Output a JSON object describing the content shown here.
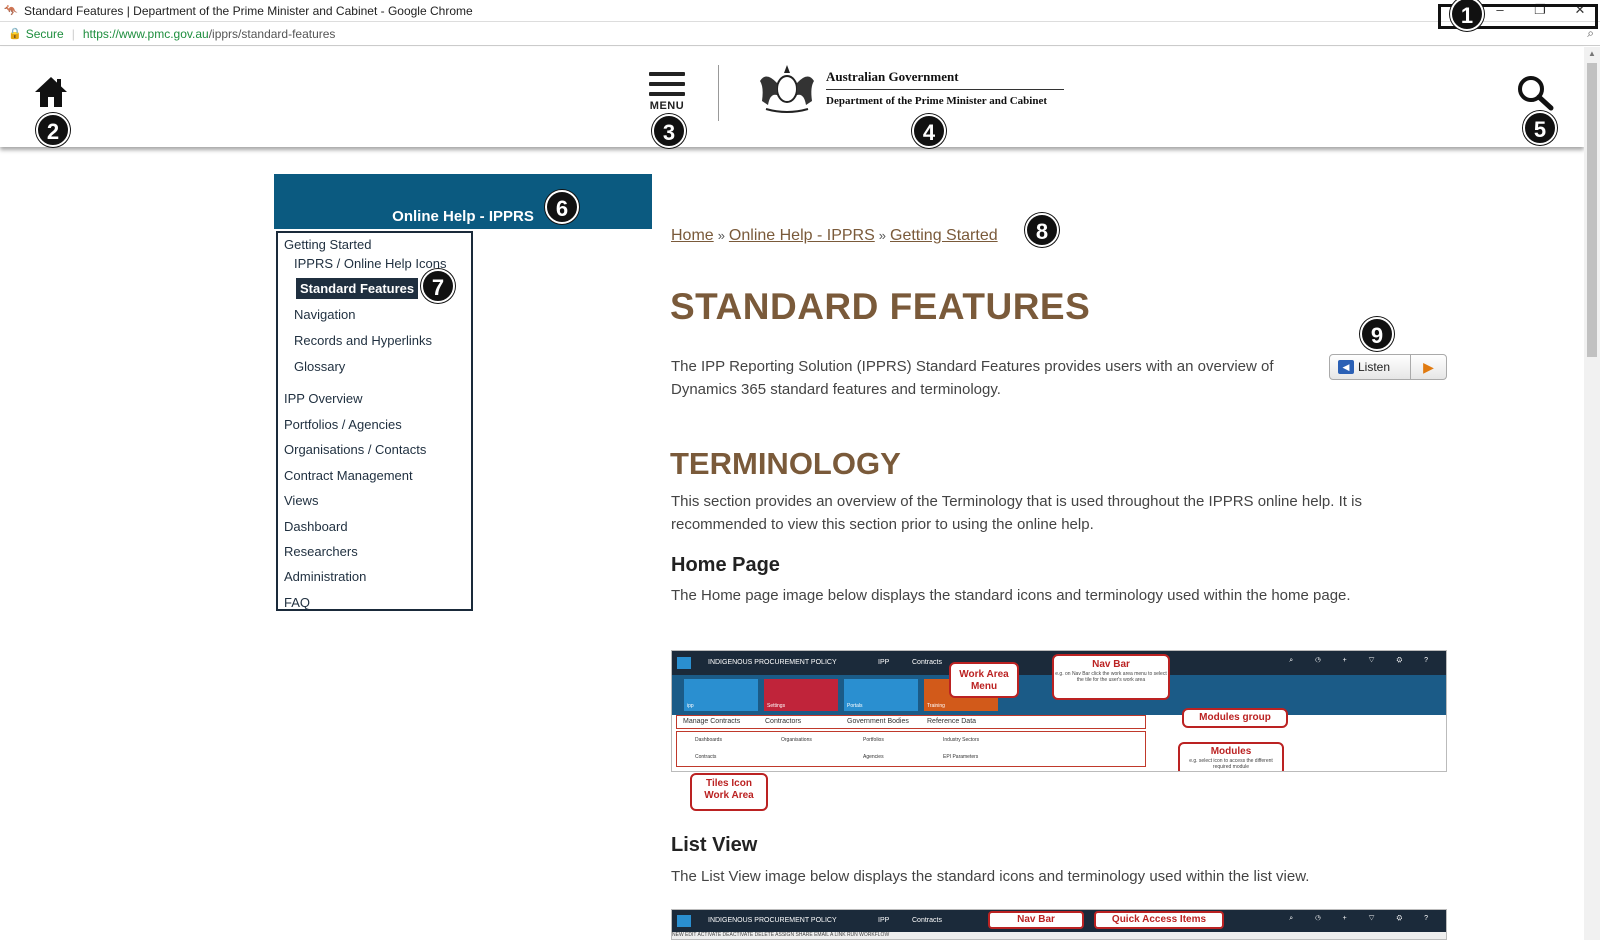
{
  "browser": {
    "window_title": "Standard Features | Department of the Prime Minister and Cabinet - Google Chrome",
    "secure_label": "Secure",
    "url_host": "https://www.pmc.gov.au",
    "url_path": "/ipprs/standard-features",
    "controls": {
      "minimize": "–",
      "restore": "❐",
      "close": "✕"
    }
  },
  "header": {
    "menu_label": "MENU",
    "gov_line1": "Australian Government",
    "gov_line2": "Department of the Prime Minister and Cabinet"
  },
  "markers": [
    "1",
    "2",
    "3",
    "4",
    "5",
    "6",
    "7",
    "8",
    "9"
  ],
  "sidebar": {
    "title": "Online Help - IPPRS",
    "items": [
      {
        "label": "Getting Started"
      },
      {
        "label": "IPPRS / Online Help Icons"
      },
      {
        "label": "Standard Features"
      },
      {
        "label": "Navigation"
      },
      {
        "label": "Records and Hyperlinks"
      },
      {
        "label": "Glossary"
      },
      {
        "label": "IPP Overview"
      },
      {
        "label": "Portfolios / Agencies"
      },
      {
        "label": "Organisations / Contacts"
      },
      {
        "label": "Contract Management"
      },
      {
        "label": "Views"
      },
      {
        "label": "Dashboard"
      },
      {
        "label": "Researchers"
      },
      {
        "label": "Administration"
      },
      {
        "label": "FAQ"
      }
    ]
  },
  "breadcrumb": {
    "home": "Home",
    "section": "Online Help - IPPRS",
    "current": "Getting Started",
    "separator": "»"
  },
  "main": {
    "title": "STANDARD FEATURES",
    "intro": "The IPP Reporting Solution (IPPRS) Standard Features provides users with an overview of Dynamics 365 standard features and terminology.",
    "listen_label": "Listen",
    "terminology_heading": "TERMINOLOGY",
    "terminology_text": "This section provides an overview of the Terminology that is used throughout the IPPRS online help. It is recommended to view this section prior to using the online help.",
    "home_page_heading": "Home Page",
    "home_page_text": "The Home page image below displays the standard icons and terminology used within the home page.",
    "list_view_heading": "List View",
    "list_view_text": "The List View image below displays the standard icons and terminology used within the list view."
  },
  "home_shot": {
    "app_name": "INDIGENOUS PROCUREMENT POLICY",
    "ipp": "IPP",
    "contracts": "Contracts",
    "tiles": [
      "ipp",
      "Settings",
      "Portals",
      "Training"
    ],
    "groups": [
      "Manage Contracts",
      "Contractors",
      "Government Bodies",
      "Reference Data"
    ],
    "modules": [
      "Dashboards",
      "Contracts",
      "Organisations",
      "Portfolios",
      "Agencies",
      "Industry Sectors",
      "EPI Parameters"
    ],
    "callouts": {
      "work_area_menu": "Work Area Menu",
      "nav_bar": "Nav Bar",
      "nav_bar_note": "e.g. on Nav Bar click the work area menu to select the tile for the user's work area",
      "modules_group": "Modules group",
      "modules": "Modules",
      "modules_note": "e.g. select icon to access the different required module",
      "tiles_icon": "Tiles Icon Work Area"
    }
  },
  "list_shot": {
    "app_name": "INDIGENOUS PROCUREMENT POLICY",
    "ipp": "IPP",
    "contracts": "Contracts",
    "nav_bar": "Nav Bar",
    "quick_access": "Quick Access Items",
    "commands": "NEW  EDIT  ACTIVATE  DEACTIVATE  DELETE  ASSIGN  SHARE  EMAIL A LINK  RUN WORKFLOW"
  }
}
